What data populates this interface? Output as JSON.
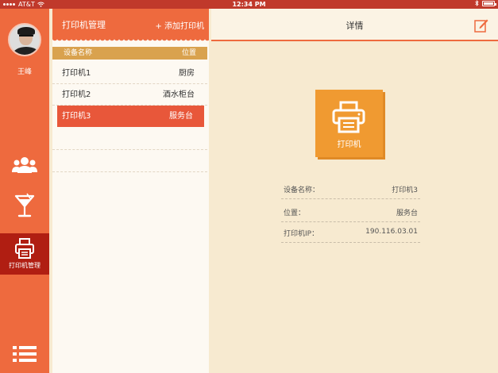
{
  "status_bar": {
    "carrier": "AT&T",
    "time": "12:34 PM"
  },
  "sidebar": {
    "username": "王峰",
    "nav": [
      {
        "icon": "users-icon",
        "label": ""
      },
      {
        "icon": "cocktail-icon",
        "label": ""
      },
      {
        "icon": "printer-icon",
        "label": "打印机管理",
        "active": true
      },
      {
        "icon": "list-menu-icon",
        "label": ""
      }
    ]
  },
  "list_panel": {
    "title": "打印机管理",
    "add_label": "+ 添加打印机",
    "columns": [
      "设备名称",
      "位置"
    ],
    "rows": [
      {
        "name": "打印机1",
        "location": "厨房"
      },
      {
        "name": "打印机2",
        "location": "酒水柜台"
      },
      {
        "name": "打印机3",
        "location": "服务台",
        "selected": true
      }
    ]
  },
  "detail": {
    "title": "详情",
    "printer_label": "打印机",
    "fields": [
      {
        "key": "设备名称：",
        "value": "打印机3"
      },
      {
        "key": "位置：",
        "value": "服务台"
      },
      {
        "key": "打印机IP：",
        "value": "190.116.03.01"
      }
    ]
  },
  "colors": {
    "accent": "#ee6a3e",
    "active_nav": "#b01e12",
    "header_bar": "#d9a24e",
    "printer_card": "#f09a31",
    "background": "#f7ead0"
  }
}
